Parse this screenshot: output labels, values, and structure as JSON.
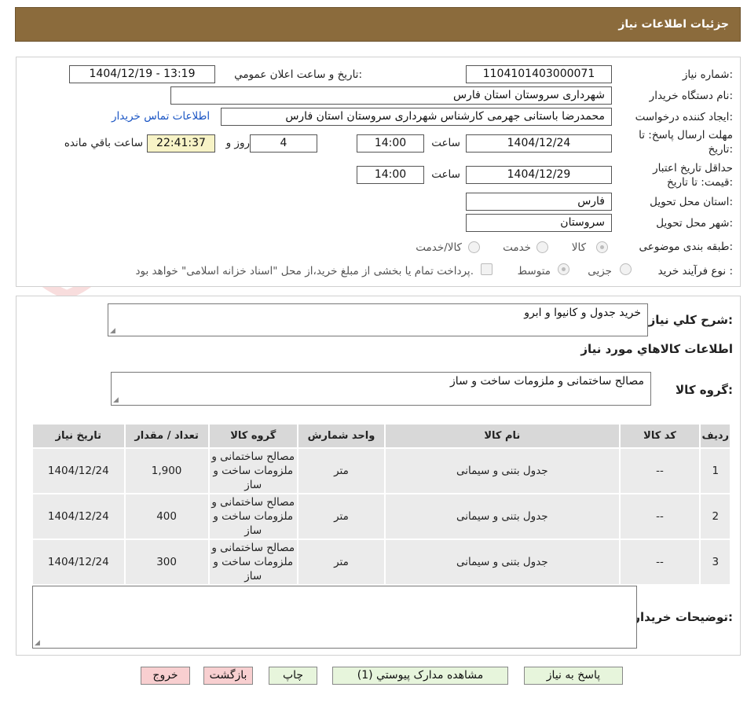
{
  "header": {
    "title": "جزئیات اطلاعات نیاز"
  },
  "fields": {
    "need_number_label": "شماره نیاز:",
    "need_number": "1104101403000071",
    "announce_label": "تاریخ و ساعت اعلان عمومي:",
    "announce_value": "1404/12/19 - 13:19",
    "buyer_org_label": "نام دستگاه خريدار:",
    "buyer_org": "شهرداری سروستان استان فارس",
    "requester_label": "ایجاد کننده درخواست:",
    "requester": "محمدرضا باستانی جهرمی کارشناس شهرداری سروستان استان فارس",
    "contact_link": "اطلاعات تماس خريدار",
    "reply_deadline_label_1": "مهلت ارسال پاسخ: تا",
    "reply_deadline_label_2": "تاريخ:",
    "reply_date": "1404/12/24",
    "time_label": "ساعت",
    "reply_time": "14:00",
    "days": "4",
    "days_label": "روز و",
    "remaining_time": "22:41:37",
    "remaining_label": "ساعت باقي مانده",
    "validity_label_1": "حداقل تاريخ اعتبار",
    "validity_label_2": "قيمت: تا تاريخ:",
    "validity_date": "1404/12/29",
    "validity_time": "14:00",
    "province_label": "استان محل تحويل:",
    "province": "فارس",
    "city_label": "شهر محل تحويل:",
    "city": "سروستان",
    "category_label": "طبقه بندی موضوعی:",
    "category_options": [
      "کالا",
      "خدمت",
      "کالا/خدمت"
    ],
    "process_label": "نوع فرآیند خرید :",
    "process_options": [
      "جزیی",
      "متوسط"
    ],
    "payment_note": "پرداخت تمام یا بخشی از مبلغ خرید،از محل \"اسناد خزانه اسلامی\" خواهد بود."
  },
  "summary": {
    "label": "شرح کلي نياز:",
    "value": "خرید جدول و کانیوا و ابرو"
  },
  "goods": {
    "section_title": "اطلاعات کالاهاي مورد نياز",
    "group_label": "گروه کالا:",
    "group_value": "مصالح ساختمانی و ملزومات ساخت و ساز"
  },
  "table": {
    "headers": [
      "رديف",
      "کد کالا",
      "نام کالا",
      "واحد شمارش",
      "گروه کالا",
      "تعداد / مقدار",
      "تاريخ نياز"
    ],
    "rows": [
      [
        "1",
        "--",
        "جدول بتنی و سیمانی",
        "متر",
        "مصالح ساختمانی و ملزومات ساخت و ساز",
        "1,900",
        "1404/12/24"
      ],
      [
        "2",
        "--",
        "جدول بتنی و سیمانی",
        "متر",
        "مصالح ساختمانی و ملزومات ساخت و ساز",
        "400",
        "1404/12/24"
      ],
      [
        "3",
        "--",
        "جدول بتنی و سیمانی",
        "متر",
        "مصالح ساختمانی و ملزومات ساخت و ساز",
        "300",
        "1404/12/24"
      ]
    ]
  },
  "buyer_notes": {
    "label": "توضيحات خريدار:",
    "value": ""
  },
  "buttons": {
    "reply": "پاسخ به نياز",
    "attachments": "مشاهده مدارک پيوستي (1)",
    "print": "چاپ",
    "back": "بازگشت",
    "exit": "خروج"
  },
  "watermark": "AriaTender.neT",
  "colors": {
    "header_bg": "#8b6b3c",
    "link": "#1a55c4",
    "btn_green": "#e7f5dc",
    "btn_red": "#f8cfd0",
    "timer_bg": "#f7f3c6"
  }
}
